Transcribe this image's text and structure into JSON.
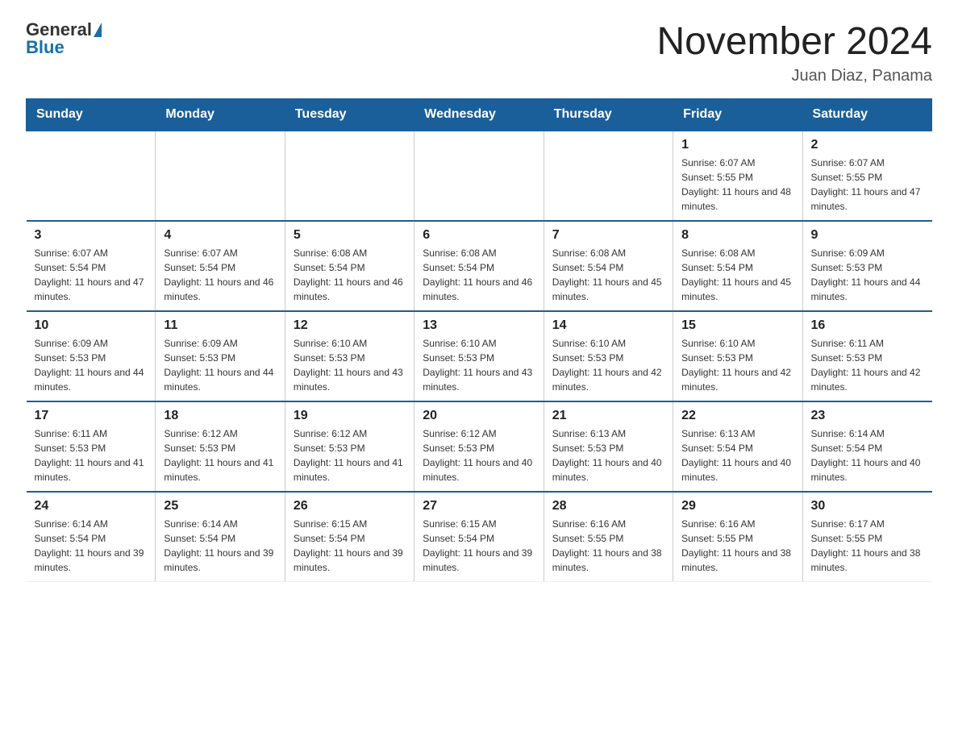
{
  "logo": {
    "general": "General",
    "blue": "Blue"
  },
  "title": "November 2024",
  "subtitle": "Juan Diaz, Panama",
  "days_of_week": [
    "Sunday",
    "Monday",
    "Tuesday",
    "Wednesday",
    "Thursday",
    "Friday",
    "Saturday"
  ],
  "weeks": [
    [
      {
        "day": "",
        "info": ""
      },
      {
        "day": "",
        "info": ""
      },
      {
        "day": "",
        "info": ""
      },
      {
        "day": "",
        "info": ""
      },
      {
        "day": "",
        "info": ""
      },
      {
        "day": "1",
        "info": "Sunrise: 6:07 AM\nSunset: 5:55 PM\nDaylight: 11 hours and 48 minutes."
      },
      {
        "day": "2",
        "info": "Sunrise: 6:07 AM\nSunset: 5:55 PM\nDaylight: 11 hours and 47 minutes."
      }
    ],
    [
      {
        "day": "3",
        "info": "Sunrise: 6:07 AM\nSunset: 5:54 PM\nDaylight: 11 hours and 47 minutes."
      },
      {
        "day": "4",
        "info": "Sunrise: 6:07 AM\nSunset: 5:54 PM\nDaylight: 11 hours and 46 minutes."
      },
      {
        "day": "5",
        "info": "Sunrise: 6:08 AM\nSunset: 5:54 PM\nDaylight: 11 hours and 46 minutes."
      },
      {
        "day": "6",
        "info": "Sunrise: 6:08 AM\nSunset: 5:54 PM\nDaylight: 11 hours and 46 minutes."
      },
      {
        "day": "7",
        "info": "Sunrise: 6:08 AM\nSunset: 5:54 PM\nDaylight: 11 hours and 45 minutes."
      },
      {
        "day": "8",
        "info": "Sunrise: 6:08 AM\nSunset: 5:54 PM\nDaylight: 11 hours and 45 minutes."
      },
      {
        "day": "9",
        "info": "Sunrise: 6:09 AM\nSunset: 5:53 PM\nDaylight: 11 hours and 44 minutes."
      }
    ],
    [
      {
        "day": "10",
        "info": "Sunrise: 6:09 AM\nSunset: 5:53 PM\nDaylight: 11 hours and 44 minutes."
      },
      {
        "day": "11",
        "info": "Sunrise: 6:09 AM\nSunset: 5:53 PM\nDaylight: 11 hours and 44 minutes."
      },
      {
        "day": "12",
        "info": "Sunrise: 6:10 AM\nSunset: 5:53 PM\nDaylight: 11 hours and 43 minutes."
      },
      {
        "day": "13",
        "info": "Sunrise: 6:10 AM\nSunset: 5:53 PM\nDaylight: 11 hours and 43 minutes."
      },
      {
        "day": "14",
        "info": "Sunrise: 6:10 AM\nSunset: 5:53 PM\nDaylight: 11 hours and 42 minutes."
      },
      {
        "day": "15",
        "info": "Sunrise: 6:10 AM\nSunset: 5:53 PM\nDaylight: 11 hours and 42 minutes."
      },
      {
        "day": "16",
        "info": "Sunrise: 6:11 AM\nSunset: 5:53 PM\nDaylight: 11 hours and 42 minutes."
      }
    ],
    [
      {
        "day": "17",
        "info": "Sunrise: 6:11 AM\nSunset: 5:53 PM\nDaylight: 11 hours and 41 minutes."
      },
      {
        "day": "18",
        "info": "Sunrise: 6:12 AM\nSunset: 5:53 PM\nDaylight: 11 hours and 41 minutes."
      },
      {
        "day": "19",
        "info": "Sunrise: 6:12 AM\nSunset: 5:53 PM\nDaylight: 11 hours and 41 minutes."
      },
      {
        "day": "20",
        "info": "Sunrise: 6:12 AM\nSunset: 5:53 PM\nDaylight: 11 hours and 40 minutes."
      },
      {
        "day": "21",
        "info": "Sunrise: 6:13 AM\nSunset: 5:53 PM\nDaylight: 11 hours and 40 minutes."
      },
      {
        "day": "22",
        "info": "Sunrise: 6:13 AM\nSunset: 5:54 PM\nDaylight: 11 hours and 40 minutes."
      },
      {
        "day": "23",
        "info": "Sunrise: 6:14 AM\nSunset: 5:54 PM\nDaylight: 11 hours and 40 minutes."
      }
    ],
    [
      {
        "day": "24",
        "info": "Sunrise: 6:14 AM\nSunset: 5:54 PM\nDaylight: 11 hours and 39 minutes."
      },
      {
        "day": "25",
        "info": "Sunrise: 6:14 AM\nSunset: 5:54 PM\nDaylight: 11 hours and 39 minutes."
      },
      {
        "day": "26",
        "info": "Sunrise: 6:15 AM\nSunset: 5:54 PM\nDaylight: 11 hours and 39 minutes."
      },
      {
        "day": "27",
        "info": "Sunrise: 6:15 AM\nSunset: 5:54 PM\nDaylight: 11 hours and 39 minutes."
      },
      {
        "day": "28",
        "info": "Sunrise: 6:16 AM\nSunset: 5:55 PM\nDaylight: 11 hours and 38 minutes."
      },
      {
        "day": "29",
        "info": "Sunrise: 6:16 AM\nSunset: 5:55 PM\nDaylight: 11 hours and 38 minutes."
      },
      {
        "day": "30",
        "info": "Sunrise: 6:17 AM\nSunset: 5:55 PM\nDaylight: 11 hours and 38 minutes."
      }
    ]
  ]
}
